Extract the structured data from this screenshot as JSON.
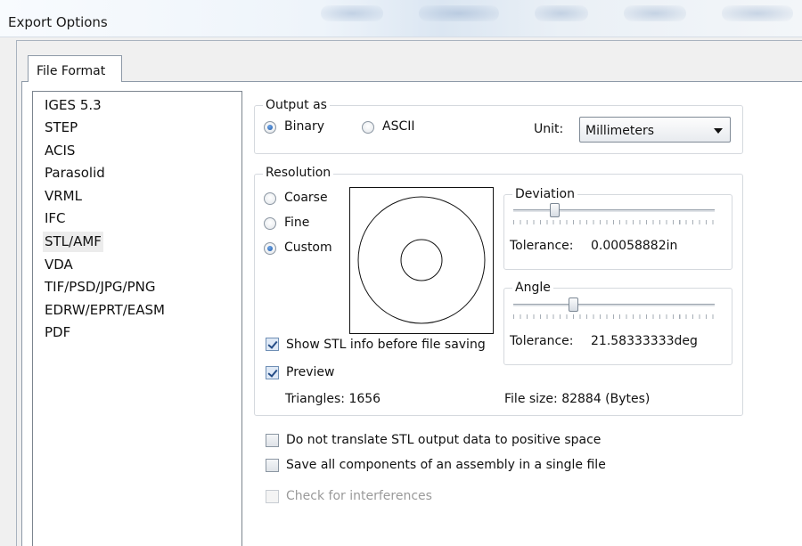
{
  "window": {
    "title": "Export Options"
  },
  "tabs": [
    {
      "label": "File Format"
    }
  ],
  "formats": [
    {
      "label": "IGES 5.3",
      "selected": false
    },
    {
      "label": "STEP",
      "selected": false
    },
    {
      "label": "ACIS",
      "selected": false
    },
    {
      "label": "Parasolid",
      "selected": false
    },
    {
      "label": "VRML",
      "selected": false
    },
    {
      "label": "IFC",
      "selected": false
    },
    {
      "label": "STL/AMF",
      "selected": true
    },
    {
      "label": "VDA",
      "selected": false
    },
    {
      "label": "TIF/PSD/JPG/PNG",
      "selected": false
    },
    {
      "label": "EDRW/EPRT/EASM",
      "selected": false
    },
    {
      "label": "PDF",
      "selected": false
    }
  ],
  "output": {
    "legend": "Output as",
    "binary_label": "Binary",
    "ascii_label": "ASCII",
    "selected": "binary",
    "unit_label": "Unit:",
    "unit_value": "Millimeters"
  },
  "resolution": {
    "legend": "Resolution",
    "options": [
      {
        "label": "Coarse",
        "checked": false
      },
      {
        "label": "Fine",
        "checked": false
      },
      {
        "label": "Custom",
        "checked": true
      }
    ],
    "show_info_label": "Show STL info before file saving",
    "show_info_checked": true,
    "preview_label": "Preview",
    "preview_checked": true,
    "triangles_text": "Triangles: 1656",
    "filesize_text": "File size: 82884 (Bytes)"
  },
  "deviation": {
    "legend": "Deviation",
    "tolerance_label": "Tolerance:",
    "tolerance_value": "0.00058882in",
    "slider_fraction": 0.19
  },
  "angle": {
    "legend": "Angle",
    "tolerance_label": "Tolerance:",
    "tolerance_value": "21.58333333deg",
    "slider_fraction": 0.29
  },
  "options": {
    "no_translate_label": "Do not translate STL output data to positive space",
    "no_translate_checked": false,
    "single_file_label": "Save all components of an assembly in a single file",
    "single_file_checked": false,
    "interference_label": "Check for interferences",
    "interference_checked": false,
    "interference_enabled": false
  },
  "colors": {
    "accent": "#1f5aa8",
    "border": "#8e9aa8",
    "panel": "#ffffff"
  }
}
